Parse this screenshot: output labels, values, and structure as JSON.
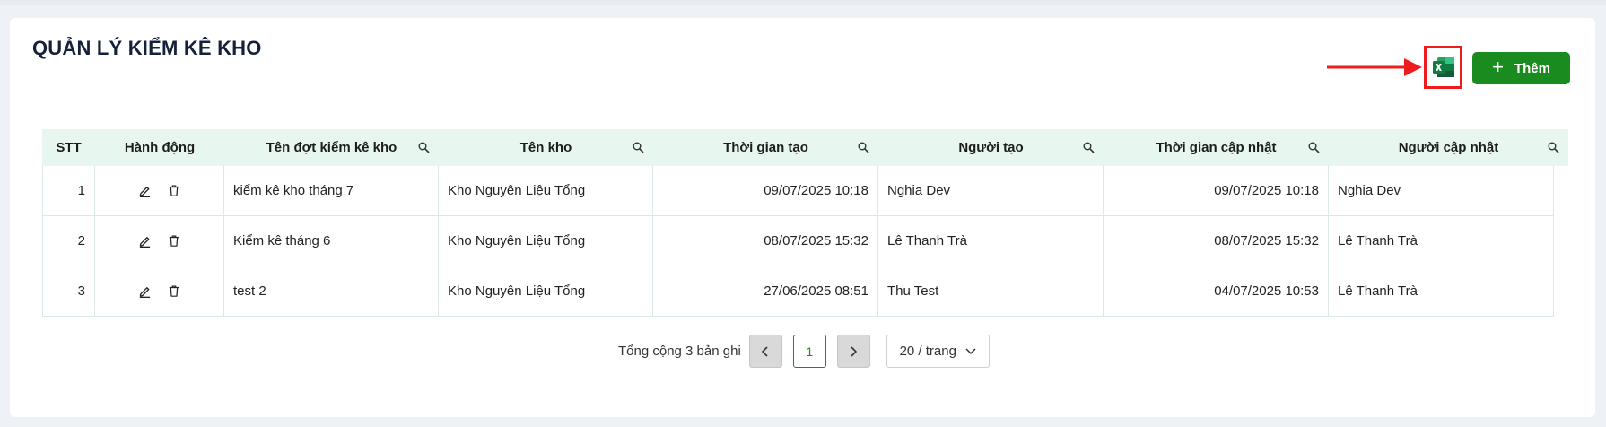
{
  "page": {
    "title": "QUẢN LÝ KIỂM KÊ KHO"
  },
  "header_actions": {
    "excel_icon": "excel-icon",
    "add_label": "Thêm",
    "add_icon": "plus-icon",
    "annotation": "red-arrow-highlight"
  },
  "table": {
    "columns": [
      {
        "label": "STT",
        "searchable": false
      },
      {
        "label": "Hành động",
        "searchable": false
      },
      {
        "label": "Tên đợt kiểm kê kho",
        "searchable": true
      },
      {
        "label": "Tên kho",
        "searchable": true
      },
      {
        "label": "Thời gian tạo",
        "searchable": true
      },
      {
        "label": "Người tạo",
        "searchable": true
      },
      {
        "label": "Thời gian cập nhật",
        "searchable": true
      },
      {
        "label": "Người cập nhật",
        "searchable": true
      }
    ],
    "rows": [
      {
        "stt": "1",
        "name": "kiểm kê kho tháng 7",
        "warehouse": "Kho Nguyên Liệu Tổng",
        "created_at": "09/07/2025 10:18",
        "created_by": "Nghia Dev",
        "updated_at": "09/07/2025 10:18",
        "updated_by": "Nghia Dev"
      },
      {
        "stt": "2",
        "name": "Kiểm kê tháng 6",
        "warehouse": "Kho Nguyên Liệu Tổng",
        "created_at": "08/07/2025 15:32",
        "created_by": "Lê Thanh Trà",
        "updated_at": "08/07/2025 15:32",
        "updated_by": "Lê Thanh Trà"
      },
      {
        "stt": "3",
        "name": "test 2",
        "warehouse": "Kho Nguyên Liệu Tổng",
        "created_at": "27/06/2025 08:51",
        "created_by": "Thu Test",
        "updated_at": "04/07/2025 10:53",
        "updated_by": "Lê Thanh Trà"
      }
    ]
  },
  "pagination": {
    "total_text": "Tổng cộng 3 bản ghi",
    "current_page": "1",
    "page_size": "20 / trang"
  },
  "colors": {
    "accent": "#1a8b1e",
    "header_bg": "#e7f6ee",
    "highlight": "#ee1c1c",
    "title": "#15213a"
  }
}
